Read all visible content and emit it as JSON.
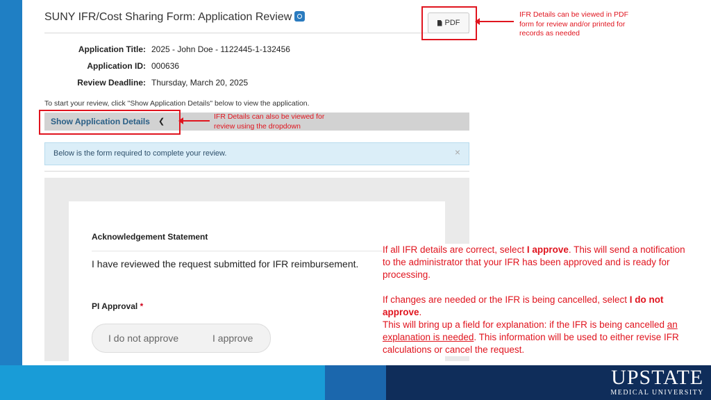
{
  "app": {
    "title": "SUNY IFR/Cost Sharing Form: Application Review",
    "pdf_label": "PDF",
    "fields": [
      {
        "label": "Application Title:",
        "value": "2025 - John Doe - 1122445-1-132456"
      },
      {
        "label": "Application ID:",
        "value": "000636"
      },
      {
        "label": "Review Deadline:",
        "value": "Thursday, March 20, 2025"
      }
    ],
    "hint": "To start your review, click \"Show Application Details\" below to view the application.",
    "details_button": "Show Application Details",
    "caret": "❮",
    "alert_text": "Below is the form required to complete your review.",
    "alert_close": "×"
  },
  "form": {
    "ack_title": "Acknowledgement Statement",
    "ack_text": "I have reviewed the request submitted for IFR reimbursement.",
    "pi_label": "PI Approval",
    "required_mark": "*",
    "option_not_approve": "I do not approve",
    "option_approve": "I approve"
  },
  "annotations": {
    "pdf_note": "IFR Details can be viewed in PDF form for review and/or printed for records as needed",
    "dropdown_note": "IFR Details can also be viewed for review using the dropdown",
    "p1_a": "If all IFR details are correct, select ",
    "p1_b": "I approve",
    "p1_c": ". This will send a notification to the administrator that your IFR has been approved and is ready for processing.",
    "p2_a": "If changes are needed or the IFR is being cancelled, select ",
    "p2_b": "I do not approve",
    "p2_c": ".",
    "p3_a": "This will bring up a field for explanation: if the IFR is being cancelled ",
    "p3_b": "an explanation is needed",
    "p3_c": ". This information will be used to either revise IFR calculations or cancel the request."
  },
  "footer": {
    "logo_big": "UPSTATE",
    "logo_small": "MEDICAL UNIVERSITY"
  },
  "colors": {
    "accent_red": "#e0141e",
    "left_bar": "#1f7fc4",
    "footer_light": "#199cd7",
    "footer_mid": "#1b67ad",
    "footer_dark": "#0f2d5a"
  }
}
